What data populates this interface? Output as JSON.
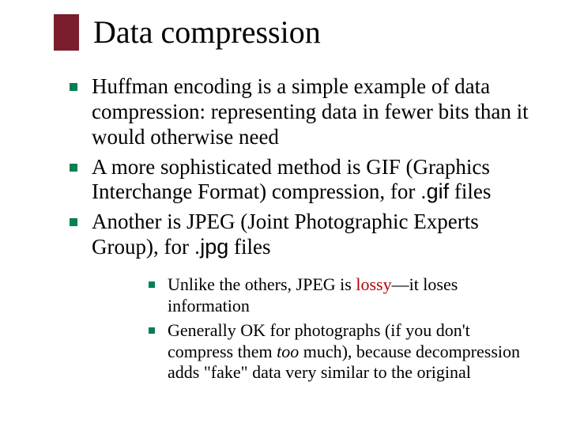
{
  "title": "Data compression",
  "bullets": {
    "b1": {
      "pre": "Huffman encoding is a simple example of ",
      "term": "data compression:",
      "post": " representing data in fewer bits than it would otherwise need"
    },
    "b2": {
      "pre": "A more sophisticated method is GIF (Graphics Interchange Format) compression, for ",
      "mono": ".gif",
      "post": " files"
    },
    "b3": {
      "pre": "Another is JPEG (Joint Photographic Experts Group), for ",
      "mono": ".jpg",
      "post": " files"
    }
  },
  "sub": {
    "s1": {
      "pre": "Unlike the others, JPEG is ",
      "term": "lossy",
      "post": "—it loses information"
    },
    "s2": {
      "pre": "Generally OK for photographs (if you don't compress them ",
      "ital": "too",
      "post": " much), because decompression adds \"fake\" data very similar to the original"
    }
  }
}
